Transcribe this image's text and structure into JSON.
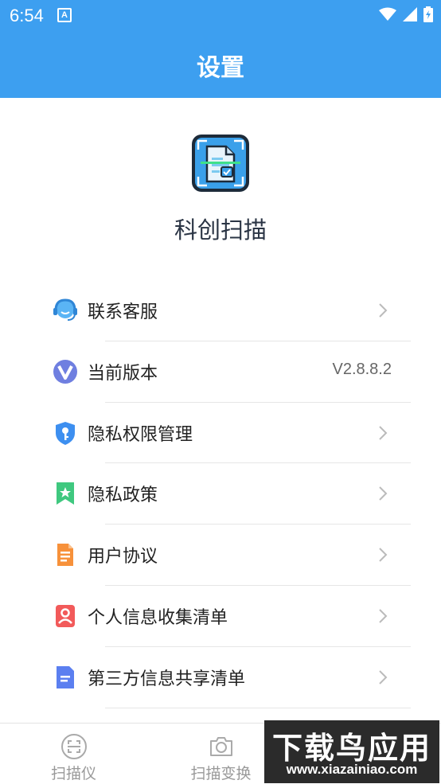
{
  "status_bar": {
    "time": "6:54",
    "notification_icon": "A"
  },
  "header": {
    "title": "设置"
  },
  "app": {
    "name": "科创扫描"
  },
  "menu": [
    {
      "label": "联系客服",
      "icon": "customer-service-icon",
      "value": "",
      "has_chevron": true
    },
    {
      "label": "当前版本",
      "icon": "version-icon",
      "value": "V2.8.8.2",
      "has_chevron": false
    },
    {
      "label": "隐私权限管理",
      "icon": "shield-key-icon",
      "value": "",
      "has_chevron": true
    },
    {
      "label": "隐私政策",
      "icon": "bookmark-star-icon",
      "value": "",
      "has_chevron": true
    },
    {
      "label": "用户协议",
      "icon": "document-icon",
      "value": "",
      "has_chevron": true
    },
    {
      "label": "个人信息收集清单",
      "icon": "person-card-icon",
      "value": "",
      "has_chevron": true
    },
    {
      "label": "第三方信息共享清单",
      "icon": "note-icon",
      "value": "",
      "has_chevron": true
    }
  ],
  "tabbar": {
    "tabs": [
      {
        "label": "扫描仪",
        "icon": "scanner-icon"
      },
      {
        "label": "扫描变换",
        "icon": "camera-icon"
      }
    ]
  },
  "watermark": {
    "title": "下载鸟应用",
    "url": "www.xiazainiao.com"
  },
  "colors": {
    "primary": "#3d9ff0",
    "text": "#222222",
    "divider": "#e6e6e6"
  }
}
